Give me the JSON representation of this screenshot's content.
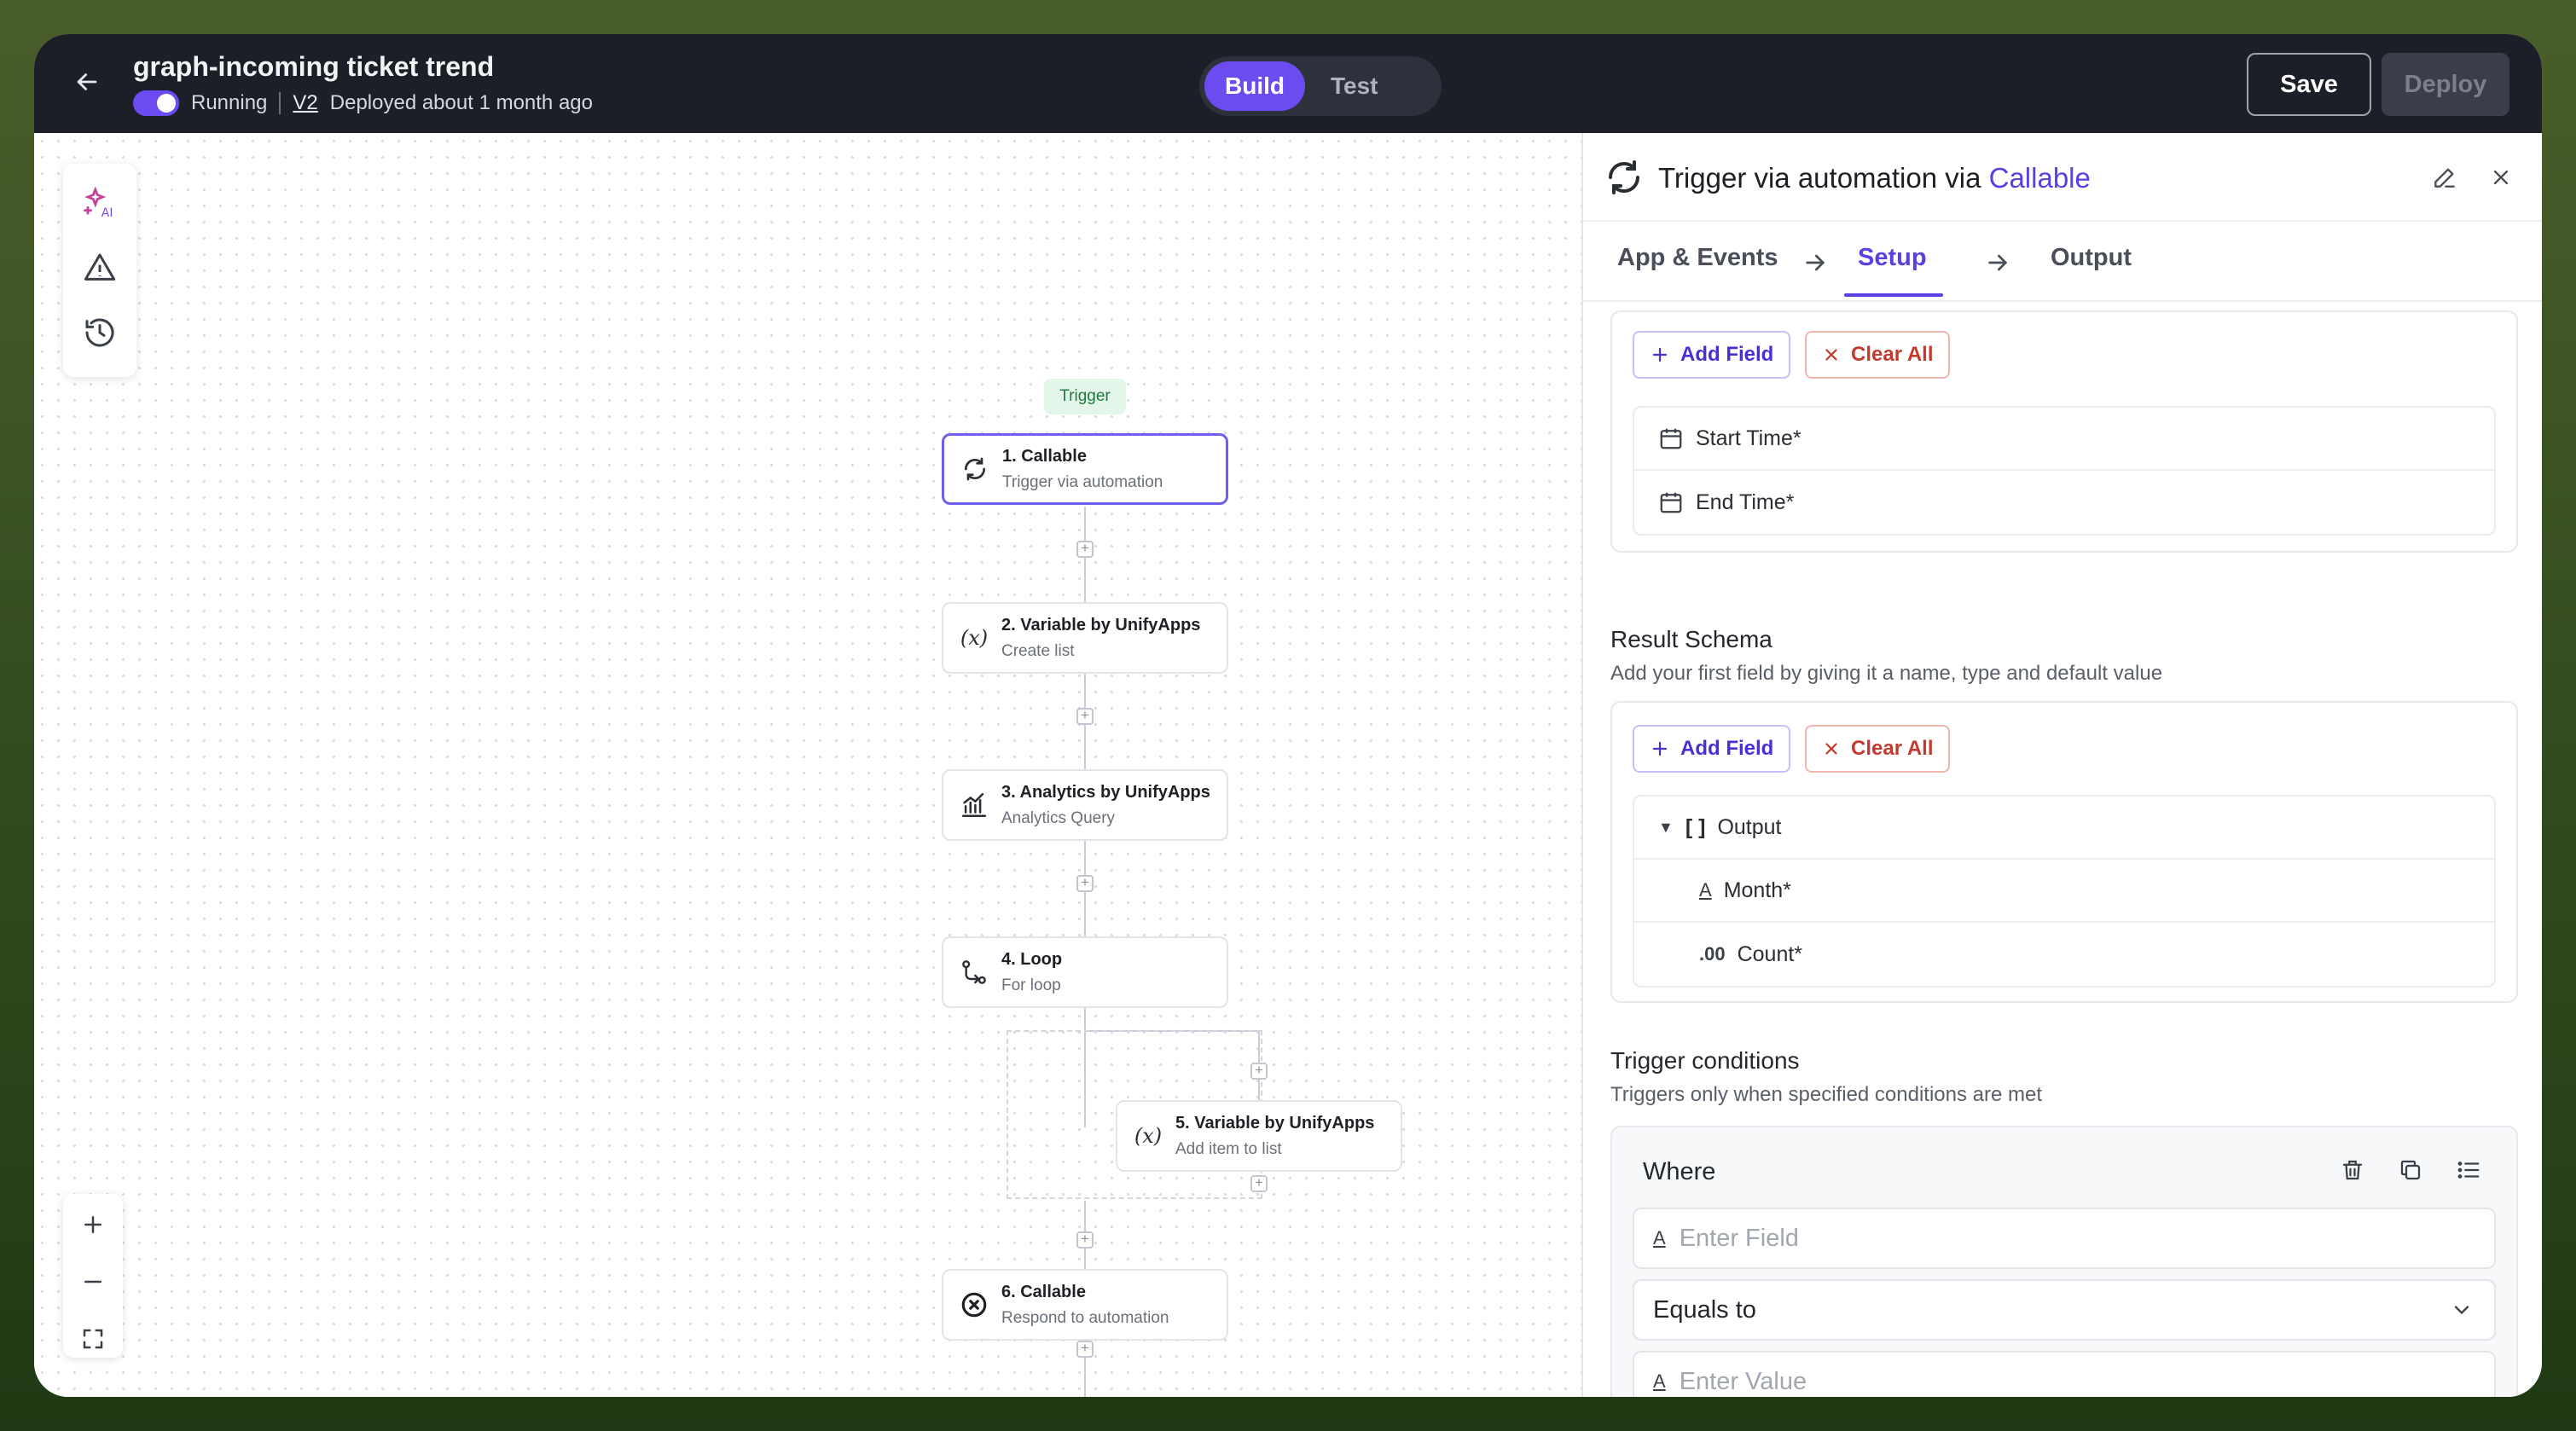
{
  "header": {
    "title": "graph-incoming ticket trend",
    "status": "Running",
    "version": "V2",
    "deployed": "Deployed about 1 month ago",
    "modes": [
      "Build",
      "Test"
    ],
    "active_mode": "Build",
    "save_label": "Save",
    "deploy_label": "Deploy"
  },
  "canvas": {
    "trigger_badge": "Trigger",
    "nodes": [
      {
        "title": "1. Callable",
        "subtitle": "Trigger via automation",
        "icon": "refresh-icon"
      },
      {
        "title": "2. Variable by UnifyApps",
        "subtitle": "Create list",
        "icon": "variable-icon"
      },
      {
        "title": "3. Analytics by UnifyApps",
        "subtitle": "Analytics Query",
        "icon": "analytics-icon"
      },
      {
        "title": "4. Loop",
        "subtitle": "For loop",
        "icon": "loop-icon"
      },
      {
        "title": "5. Variable by UnifyApps",
        "subtitle": "Add item to list",
        "icon": "variable-icon"
      },
      {
        "title": "6. Callable",
        "subtitle": "Respond to automation",
        "icon": "close-circle-icon"
      }
    ],
    "variable_glyph": "(x)"
  },
  "panel": {
    "title_prefix": "Trigger via automation via",
    "title_accent": "Callable",
    "tabs": [
      "App & Events",
      "Setup",
      "Output"
    ],
    "active_tab": "Setup",
    "params": {
      "add_label": "Add Field",
      "clear_label": "Clear All",
      "fields": [
        "Start Time*",
        "End Time*"
      ]
    },
    "result_schema": {
      "title": "Result Schema",
      "subtitle": "Add your first field by giving it a name, type and default value",
      "add_label": "Add Field",
      "clear_label": "Clear All",
      "root": "Output",
      "root_marker": "[ ]",
      "children": [
        {
          "label": "Month*",
          "type_glyph": "A"
        },
        {
          "label": "Count*",
          "type_glyph": ".00"
        }
      ]
    },
    "conditions": {
      "title": "Trigger conditions",
      "subtitle": "Triggers only when specified conditions are met",
      "where_label": "Where",
      "field_placeholder": "Enter Field",
      "operator": "Equals to",
      "value_placeholder": "Enter Value"
    }
  },
  "colors": {
    "accent": "#5b3fe0",
    "topbar": "#1c1f27",
    "danger": "#c23a2e"
  }
}
